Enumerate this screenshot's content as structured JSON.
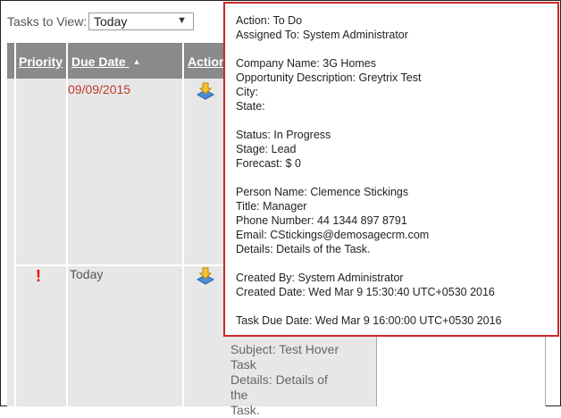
{
  "toolbar": {
    "tasks_label": "Tasks to View:",
    "tasks_value": "Today",
    "dropdown_arrow": "▼"
  },
  "grid": {
    "headers": {
      "priority": "Priority",
      "due_date": "Due Date",
      "sort_arrow": "▲",
      "action": "Action"
    },
    "rows": [
      {
        "priority": "",
        "due_date": "09/09/2015",
        "action_icon": "download-icon"
      },
      {
        "priority": "!",
        "due_date": "Today",
        "action_icon": "download-icon"
      }
    ],
    "subject_lines": [
      "Subject: Test Hover",
      "Task",
      "Details: Details of the",
      "Task."
    ]
  },
  "tooltip": {
    "action": "Action: To Do",
    "assigned_to": "Assigned To: System Administrator",
    "company_name": "Company Name: 3G Homes",
    "opportunity_description": "Opportunity Description: Greytrix Test",
    "city": "City:",
    "state": "State:",
    "status": "Status: In Progress",
    "stage": "Stage: Lead",
    "forecast": "Forecast: $ 0",
    "person_name": "Person Name: Clemence Stickings",
    "title": "Title: Manager",
    "phone": "Phone Number: 44 1344 897 8791",
    "email": "Email: CStickings@demosagecrm.com",
    "details": "Details: Details of the Task.",
    "created_by": "Created By: System Administrator",
    "created_date": "Created Date: Wed Mar 9 15:30:40 UTC+0530 2016",
    "task_due_date": "Task Due Date: Wed Mar 9 16:00:00 UTC+0530 2016"
  },
  "colors": {
    "popup_border": "#c62828",
    "header_bg": "#8a8a8a",
    "overdue_date": "#c0392b",
    "priority_alert": "#ee0000"
  }
}
